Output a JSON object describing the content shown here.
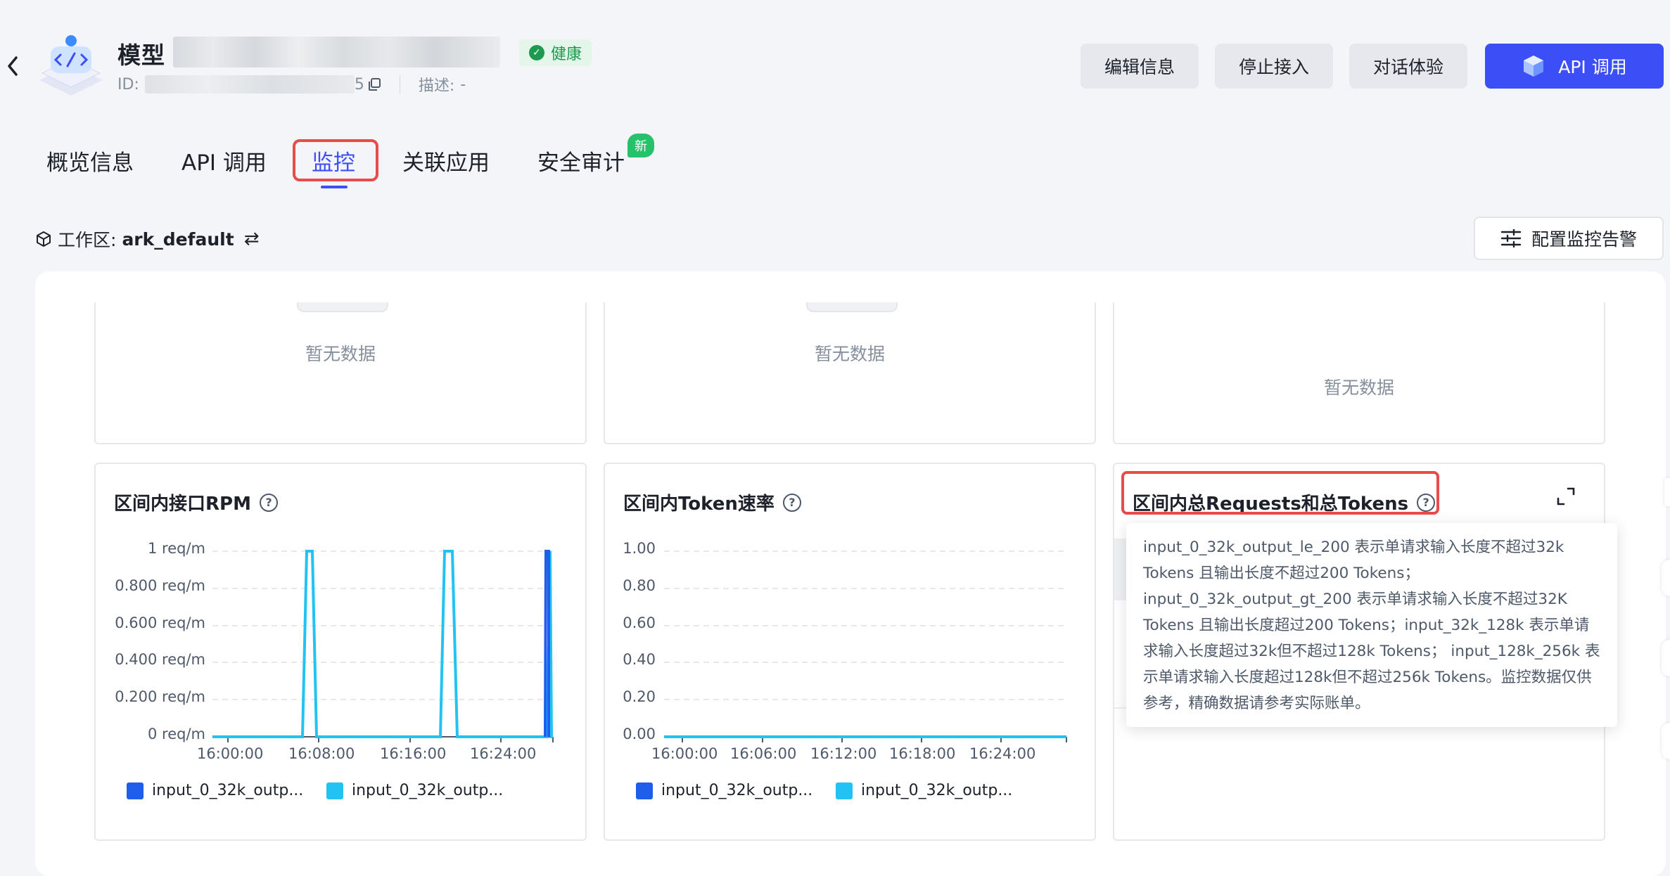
{
  "header": {
    "title": "模型",
    "status": "健康",
    "id_label": "ID:",
    "id_suffix": "5",
    "desc_label": "描述:",
    "desc_value": "-",
    "actions": {
      "edit": "编辑信息",
      "stop": "停止接入",
      "chat": "对话体验",
      "api": "API 调用"
    }
  },
  "tabs": {
    "overview": "概览信息",
    "api": "API 调用",
    "monitor": "监控",
    "apps": "关联应用",
    "audit": "安全审计",
    "new_tag": "新"
  },
  "workspace": {
    "label": "工作区:",
    "value": "ark_default",
    "switch_icon": "⇄"
  },
  "alarm_button": "配置监控告警",
  "top_cards": {
    "empty1": "暂无数据",
    "empty2": "暂无数据",
    "empty3": "暂无数据"
  },
  "cards": {
    "rpm_title": "区间内接口RPM",
    "token_title": "区间内Token速率",
    "total_title": "区间内总Requests和总Tokens"
  },
  "tooltip_text": "input_0_32k_output_le_200 表示单请求输入长度不超过32k Tokens 且输出长度不超过200 Tokens； input_0_32k_output_gt_200 表示单请求输入长度不超过32K Tokens 且输出长度超过200 Tokens；input_32k_128k 表示单请求输入长度超过32k但不超过128k Tokens； input_128k_256k 表示单请求输入长度超过128k但不超过256k Tokens。监控数据仅供参考，精确数据请参考实际账单。",
  "colors": {
    "series1": "#1e5eea",
    "series2": "#22c3f2",
    "accent": "#3c4ef5",
    "highlight": "#e94a4a"
  },
  "chart_data": [
    {
      "type": "line",
      "title": "区间内接口RPM",
      "y_ticks": [
        "1 req/m",
        "0.800 req/m",
        "0.600 req/m",
        "0.400 req/m",
        "0.200 req/m",
        "0 req/m"
      ],
      "x_ticks": [
        "16:00:00",
        "16:08:00",
        "16:16:00",
        "16:24:00"
      ],
      "ylim": [
        0,
        1
      ],
      "series": [
        {
          "name": "input_0_32k_outp...",
          "points": [
            [
              "16:28:00",
              0
            ],
            [
              "16:28:10",
              1
            ],
            [
              "16:29:00",
              1
            ],
            [
              "16:29:10",
              0
            ]
          ]
        },
        {
          "name": "input_0_32k_outp...",
          "points": [
            [
              "16:00:00",
              0
            ],
            [
              "16:06:40",
              0
            ],
            [
              "16:07:00",
              1
            ],
            [
              "16:07:30",
              1
            ],
            [
              "16:07:50",
              0
            ],
            [
              "16:18:50",
              0
            ],
            [
              "16:19:10",
              1
            ],
            [
              "16:19:40",
              1
            ],
            [
              "16:20:10",
              0
            ],
            [
              "16:28:30",
              0
            ],
            [
              "16:28:50",
              1
            ],
            [
              "16:29:10",
              0
            ]
          ]
        }
      ]
    },
    {
      "type": "line",
      "title": "区间内Token速率",
      "y_ticks": [
        "1.00",
        "0.80",
        "0.60",
        "0.40",
        "0.20",
        "0.00"
      ],
      "x_ticks": [
        "16:00:00",
        "16:06:00",
        "16:12:00",
        "16:18:00",
        "16:24:00"
      ],
      "ylim": [
        0,
        1
      ],
      "series": [
        {
          "name": "input_0_32k_outp...",
          "points": [
            [
              "16:00:00",
              0
            ],
            [
              "16:29:00",
              0
            ]
          ]
        },
        {
          "name": "input_0_32k_outp...",
          "points": [
            [
              "16:00:00",
              0
            ],
            [
              "16:29:00",
              0
            ]
          ]
        }
      ]
    }
  ]
}
